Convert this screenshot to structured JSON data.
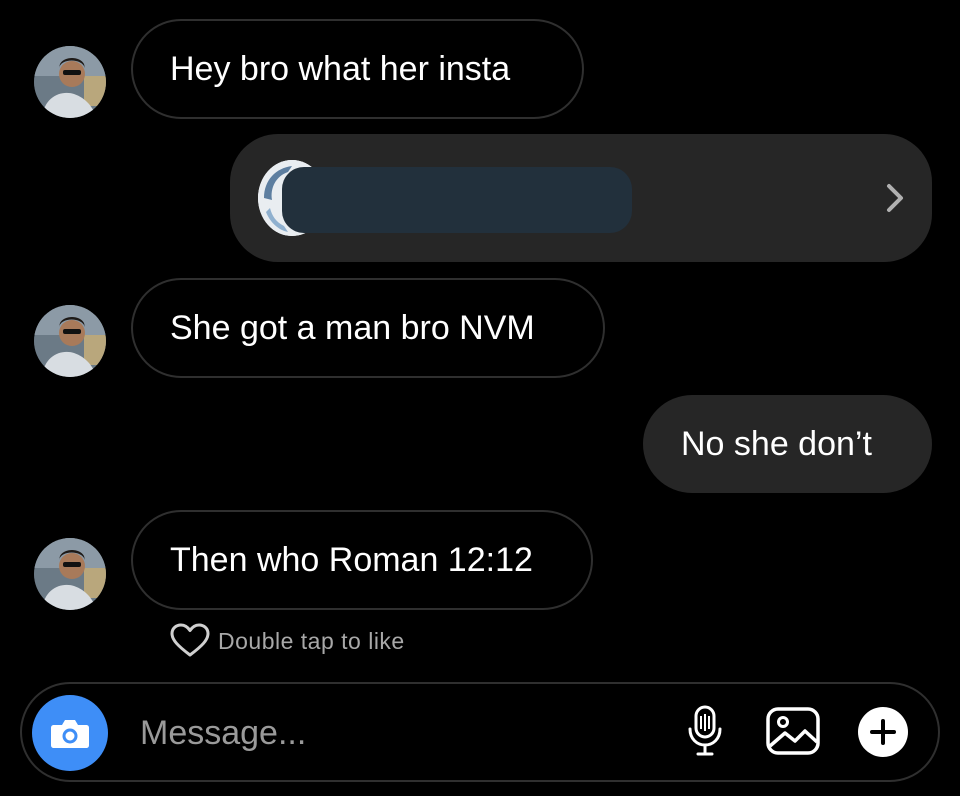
{
  "messages": [
    {
      "text": "Hey bro what her insta",
      "direction": "incoming"
    },
    {
      "text": "She got a man bro NVM",
      "direction": "incoming"
    },
    {
      "text": "No she don’t",
      "direction": "outgoing"
    },
    {
      "text": "Then who Roman 12:12",
      "direction": "incoming"
    }
  ],
  "shared_profile": {
    "redacted": true
  },
  "like_hint": "Double tap to like",
  "composer": {
    "placeholder": "Message...",
    "icons": [
      "camera-icon",
      "microphone-icon",
      "gallery-icon",
      "plus-icon"
    ]
  },
  "colors": {
    "background": "#000000",
    "bubble_outgoing": "#262626",
    "bubble_incoming_border": "#2f2f2f",
    "camera_button": "#3e8ef7"
  }
}
